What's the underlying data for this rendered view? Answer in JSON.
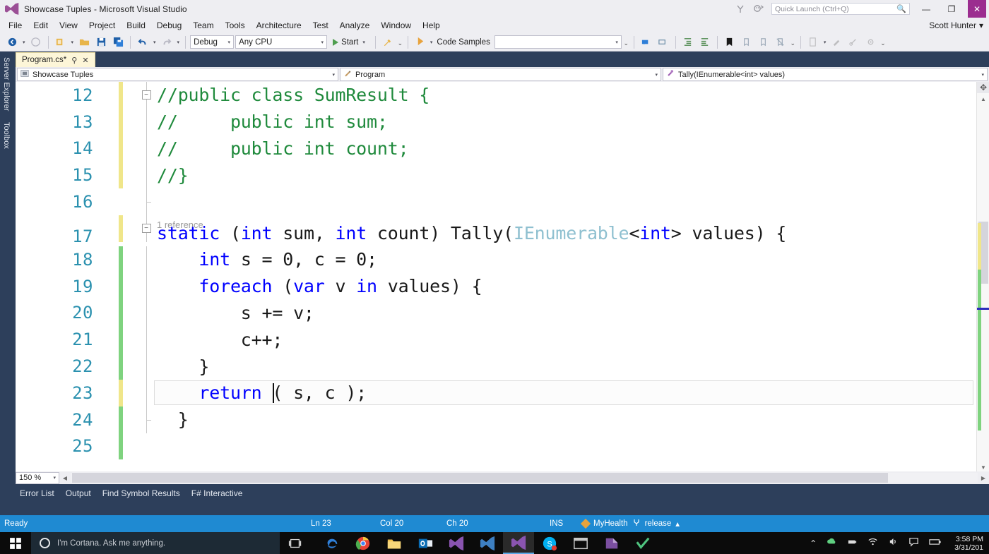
{
  "window": {
    "title": "Showcase Tuples - Microsoft Visual Studio",
    "logo_icon": "visual-studio-logo-icon",
    "minimize_label": "—",
    "restore_label": "❐",
    "close_label": "✕",
    "notify_icon": "notifications-icon",
    "feedback_icon": "feedback-smiley-icon"
  },
  "quick_launch": {
    "placeholder": "Quick Launch (Ctrl+Q)",
    "value": "",
    "search_icon": "search-icon"
  },
  "menu": {
    "items": [
      {
        "label": "File"
      },
      {
        "label": "Edit"
      },
      {
        "label": "View"
      },
      {
        "label": "Project"
      },
      {
        "label": "Build"
      },
      {
        "label": "Debug"
      },
      {
        "label": "Team"
      },
      {
        "label": "Tools"
      },
      {
        "label": "Architecture"
      },
      {
        "label": "Test"
      },
      {
        "label": "Analyze"
      },
      {
        "label": "Window"
      },
      {
        "label": "Help"
      }
    ],
    "account_name": "Scott Hunter",
    "account_caret": "▾"
  },
  "toolbar": {
    "navigate_back_icon": "navigate-back-icon",
    "navigate_forward_icon": "navigate-forward-icon",
    "new_project_icon": "new-project-icon",
    "open_file_icon": "open-file-icon",
    "save_icon": "save-icon",
    "save_all_icon": "save-all-icon",
    "undo_icon": "undo-icon",
    "redo_icon": "redo-icon",
    "config_value": "Debug",
    "platform_value": "Any CPU",
    "start_label": "Start",
    "start_icon": "play-icon",
    "attach_icon": "attach-to-process-icon",
    "code_samples_label": "Code Samples",
    "code_samples_icon": "code-samples-icon",
    "search_combo_value": "",
    "extra_icons": [
      "comment-selection-icon",
      "uncomment-selection-icon",
      "increase-indent-icon",
      "decrease-indent-icon",
      "toggle-bookmark-icon",
      "prev-bookmark-icon",
      "next-bookmark-icon",
      "clear-bookmarks-icon",
      "add-item-icon",
      "new-item-icon",
      "properties-icon",
      "settings-icon"
    ],
    "caret": "▾",
    "overflow": "⌄"
  },
  "rail": {
    "tabs": [
      {
        "label": "Server Explorer"
      },
      {
        "label": "Toolbox"
      }
    ]
  },
  "document": {
    "tab_label": "Program.cs*",
    "tab_pin_icon": "pin-icon",
    "tab_close_icon": "close-icon",
    "nav_project": "Showcase Tuples",
    "nav_project_icon": "project-icon",
    "nav_class": "Program",
    "nav_class_icon": "class-icon",
    "nav_member": "Tally(IEnumerable<int> values)",
    "nav_member_icon": "method-icon",
    "caret": "▾"
  },
  "editor": {
    "codelens": "1 reference",
    "collapse_glyph": "−",
    "zoom_level": "150 %",
    "zoom_caret": "▾",
    "lines": [
      {
        "number": "12",
        "change": "yellow",
        "outline": "start",
        "tokens": [
          {
            "t": "//public class SumResult {",
            "c": "c"
          }
        ]
      },
      {
        "number": "13",
        "change": "yellow",
        "outline": "line",
        "tokens": [
          {
            "t": "//     public int sum;",
            "c": "c"
          }
        ]
      },
      {
        "number": "14",
        "change": "yellow",
        "outline": "line",
        "tokens": [
          {
            "t": "//     public int count;",
            "c": "c"
          }
        ]
      },
      {
        "number": "15",
        "change": "yellow",
        "outline": "line",
        "tokens": [
          {
            "t": "//}",
            "c": "c"
          }
        ]
      },
      {
        "number": "16",
        "change": "none",
        "outline": "end",
        "tokens": []
      },
      {
        "number": "17",
        "change": "yellow",
        "outline": "start",
        "codelens": "1 reference",
        "tokens": [
          {
            "t": "static ",
            "c": "k"
          },
          {
            "t": "(",
            "c": "p"
          },
          {
            "t": "int",
            "c": "k"
          },
          {
            "t": " sum, ",
            "c": "p"
          },
          {
            "t": "int",
            "c": "k"
          },
          {
            "t": " count) Tally(",
            "c": "p"
          },
          {
            "t": "IEnumerable",
            "c": "t"
          },
          {
            "t": "<",
            "c": "p"
          },
          {
            "t": "int",
            "c": "k"
          },
          {
            "t": "> values) {",
            "c": "p"
          }
        ]
      },
      {
        "number": "18",
        "change": "green",
        "outline": "line",
        "tokens": [
          {
            "t": "    ",
            "c": "p"
          },
          {
            "t": "int",
            "c": "k"
          },
          {
            "t": " s = 0, c = 0;",
            "c": "p"
          }
        ]
      },
      {
        "number": "19",
        "change": "green",
        "outline": "line",
        "tokens": [
          {
            "t": "    ",
            "c": "p"
          },
          {
            "t": "foreach",
            "c": "k"
          },
          {
            "t": " (",
            "c": "p"
          },
          {
            "t": "var",
            "c": "k"
          },
          {
            "t": " v ",
            "c": "p"
          },
          {
            "t": "in",
            "c": "k"
          },
          {
            "t": " values) {",
            "c": "p"
          }
        ]
      },
      {
        "number": "20",
        "change": "green",
        "outline": "line",
        "tokens": [
          {
            "t": "        s += v;",
            "c": "p"
          }
        ]
      },
      {
        "number": "21",
        "change": "green",
        "outline": "line",
        "tokens": [
          {
            "t": "        c++;",
            "c": "p"
          }
        ]
      },
      {
        "number": "22",
        "change": "green",
        "outline": "line",
        "tokens": [
          {
            "t": "    }",
            "c": "p"
          }
        ]
      },
      {
        "number": "23",
        "change": "yellow",
        "outline": "line",
        "current": true,
        "tokens": [
          {
            "t": "    ",
            "c": "p"
          },
          {
            "t": "return",
            "c": "k"
          },
          {
            "t": " ( s, c );",
            "c": "p"
          }
        ]
      },
      {
        "number": "24",
        "change": "green",
        "outline": "end",
        "tokens": [
          {
            "t": "  }",
            "c": "p"
          }
        ]
      },
      {
        "number": "25",
        "change": "green",
        "outline": "none",
        "tokens": []
      }
    ]
  },
  "panel": {
    "tabs": [
      {
        "label": "Error List"
      },
      {
        "label": "Output"
      },
      {
        "label": "Find Symbol Results"
      },
      {
        "label": "F# Interactive"
      }
    ]
  },
  "status": {
    "ready": "Ready",
    "line": "Ln 23",
    "col": "Col 20",
    "ch": "Ch 20",
    "insert_mode": "INS",
    "repo": "MyHealth",
    "branch": "release",
    "branch_icon": "source-branch-icon",
    "repo_icon": "repository-icon",
    "up_caret": "▴"
  },
  "taskbar": {
    "start_icon": "windows-start-icon",
    "cortana_placeholder": "I'm Cortana. Ask me anything.",
    "cortana_icon": "cortana-circle-icon",
    "taskview_icon": "task-view-icon",
    "apps": [
      {
        "name": "edge-icon",
        "glyph": "e",
        "color": "#2f7fd8"
      },
      {
        "name": "chrome-icon",
        "glyph": "◉",
        "color": "#e84234"
      },
      {
        "name": "file-explorer-icon",
        "glyph": "▭",
        "color": "#f2c14e"
      },
      {
        "name": "outlook-icon",
        "glyph": "O",
        "color": "#0a6cb4"
      },
      {
        "name": "visual-studio-icon-1",
        "glyph": "⋈",
        "color": "#8a54b0"
      },
      {
        "name": "visual-studio-icon-2",
        "glyph": "⋈",
        "color": "#3d7fc1"
      },
      {
        "name": "visual-studio-icon-active",
        "glyph": "⋈",
        "color": "#8a54b0"
      },
      {
        "name": "skype-icon",
        "glyph": "S",
        "color": "#00aff0"
      },
      {
        "name": "console-icon",
        "glyph": "▭",
        "color": "#c8c8c8"
      },
      {
        "name": "onenote-icon",
        "glyph": "◣",
        "color": "#7b4fa0"
      },
      {
        "name": "checkmark-app-icon",
        "glyph": "✔",
        "color": "#4fc47f"
      }
    ],
    "tray": {
      "show_hidden": "⌃",
      "icons": [
        "onedrive-sync-icon",
        "usb-device-icon",
        "wifi-icon",
        "volume-icon",
        "action-center-icon",
        "battery-icon"
      ],
      "time": "3:58 PM",
      "date": "3/31/201"
    }
  }
}
